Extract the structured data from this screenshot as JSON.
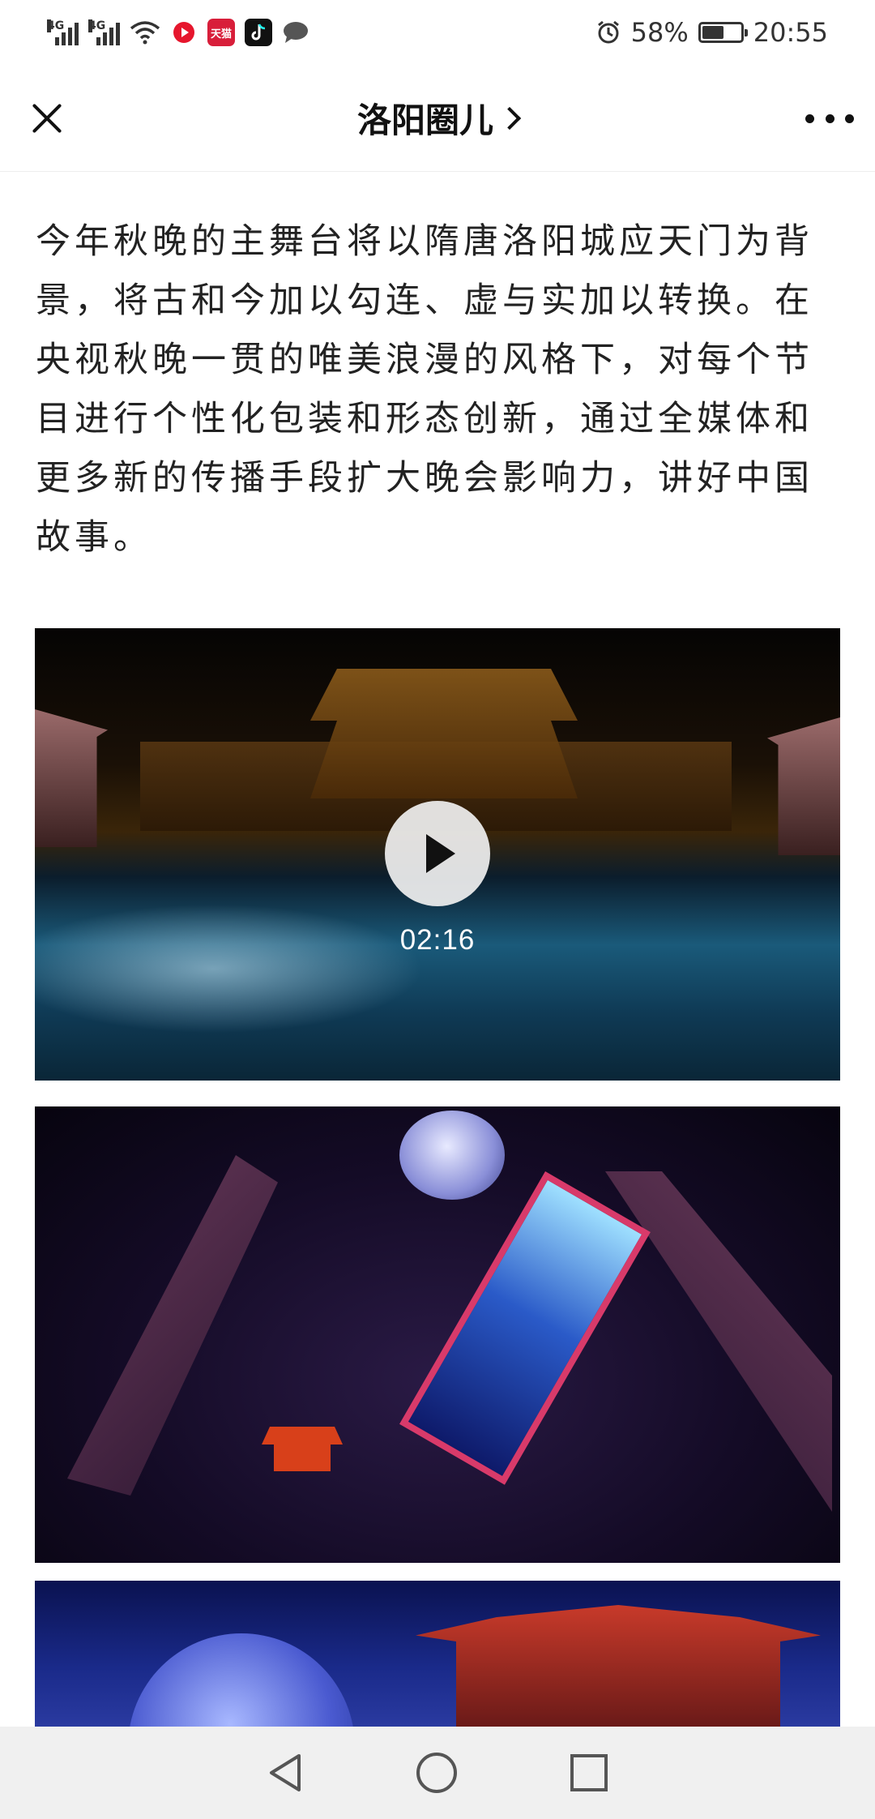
{
  "status_bar": {
    "signal1_label": "4G",
    "signal2_label": "4G",
    "battery_percent": "58%",
    "battery_level": 0.58,
    "time": "20:55",
    "icons": [
      "wifi-icon",
      "weibo-icon",
      "tmall-icon",
      "tiktok-icon",
      "message-icon",
      "alarm-icon",
      "battery-icon"
    ],
    "tmall_label": "天猫"
  },
  "nav": {
    "title": "洛阳圈儿"
  },
  "article": {
    "paragraph": "今年秋晚的主舞台将以隋唐洛阳城应天门为背景，将古和今加以勾连、虚与实加以转换。在央视秋晚一贯的唯美浪漫的风格下，对每个节目进行个性化包装和形态创新，通过全媒体和更多新的传播手段扩大晚会影响力，讲好中国故事。"
  },
  "video": {
    "duration": "02:16"
  },
  "colors": {
    "accent": "#d83a6a",
    "nav_background": "#f0f0f0"
  }
}
